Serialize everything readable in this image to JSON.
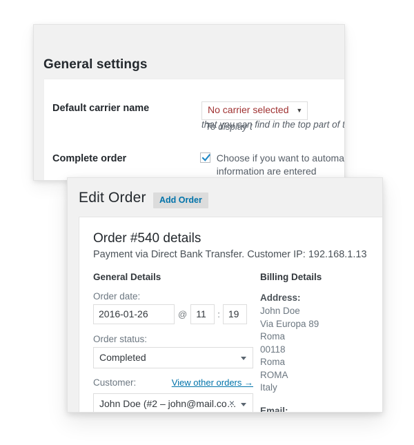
{
  "back_panel": {
    "title": "General settings",
    "rows": [
      {
        "label": "Default carrier name",
        "select_value": "No carrier selected",
        "caret": "▼",
        "hint_line1": "To display t",
        "hint_line2": "that you can find in the top part of the"
      },
      {
        "label": "Complete order",
        "checkbox_checked": true,
        "checkbox_text": "Choose if you want to automa",
        "checkbox_text_line2": "information are entered"
      }
    ]
  },
  "front_panel": {
    "title": "Edit Order",
    "add_order_label": "Add Order",
    "order_heading": "Order #540 details",
    "order_subheading": "Payment via Direct Bank Transfer. Customer IP: 192.168.1.13",
    "general_details": {
      "title": "General Details",
      "order_date_label": "Order date:",
      "order_date_value": "2016-01-26",
      "at_sign": "@",
      "hour_value": "11",
      "colon": ":",
      "minute_value": "19",
      "order_status_label": "Order status:",
      "order_status_value": "Completed",
      "customer_label": "Customer:",
      "view_other_orders": "View other orders →",
      "customer_value": "John Doe (#2 – john@mail.co…",
      "clear_glyph": "×"
    },
    "billing_details": {
      "title": "Billing Details",
      "address_label": "Address:",
      "address_lines": [
        "John Doe",
        "Via Europa 89",
        "Roma",
        "00118",
        "Roma",
        "ROMA",
        "Italy"
      ],
      "email_label": "Email:"
    }
  },
  "colors": {
    "accent_link": "#0073aa",
    "panel_bg": "#f1f1f1",
    "select_red": "#a03232",
    "check_blue": "#1e88c7"
  }
}
